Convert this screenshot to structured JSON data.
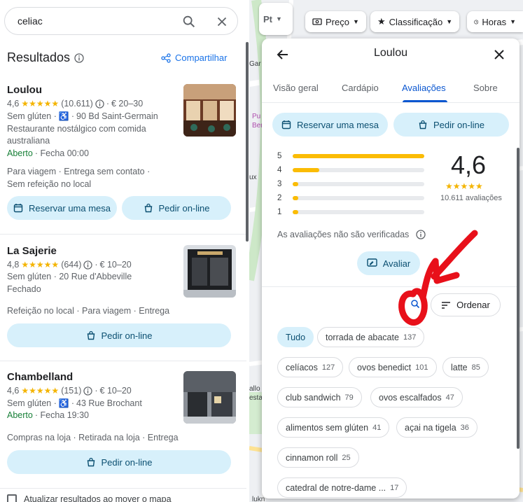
{
  "search": {
    "query": "celiac"
  },
  "results": {
    "title": "Resultados",
    "share_label": "Compartilhar"
  },
  "cards": [
    {
      "name": "Loulou",
      "rating": "4,6",
      "stars": "★★★★★",
      "count": "(10.611)",
      "price": "€ 20–30",
      "line2": "Sem glúten ·",
      "address": "90 Bd Saint-Germain",
      "desc1": "Restaurante nostálgico com comida",
      "desc2": "australiana",
      "status": "Aberto",
      "hours": "· Fecha 00:00",
      "services1": "Para viagem · Entrega sem contato ·",
      "services2": "Sem refeição no local",
      "reserve": "Reservar uma mesa",
      "order": "Pedir on-line"
    },
    {
      "name": "La Sajerie",
      "rating": "4,8",
      "stars": "★★★★★",
      "count": "(644)",
      "price": "€ 10–20",
      "line2": "Sem glúten · 20 Rue d'Abbeville",
      "status": "Fechado",
      "services1": "Refeição no local · Para viagem · Entrega",
      "order": "Pedir on-line"
    },
    {
      "name": "Chambelland",
      "rating": "4,6",
      "stars": "★★★★★",
      "count": "(151)",
      "price": "€ 10–20",
      "line2": "Sem glúten ·",
      "address": "43 Rue Brochant",
      "status": "Aberto",
      "hours": "· Fecha 19:30",
      "services1": "Compras na loja · Retirada na loja · Entrega",
      "order": "Pedir on-line"
    }
  ],
  "map_update_label": "Atualizar resultados ao mover o mapa",
  "map_toolbar": {
    "price": "Preço",
    "rating": "Classificação",
    "hours": "Horas"
  },
  "map_labels": [
    "Gar",
    "Pu",
    "Ber",
    "ux",
    "allo",
    "esta",
    "lukn"
  ],
  "panel": {
    "title": "Loulou",
    "tabs": [
      "Visão geral",
      "Cardápio",
      "Avaliações",
      "Sobre"
    ],
    "active_tab": "Avaliações",
    "reserve": "Reservar uma mesa",
    "order": "Pedir on-line",
    "rating_bars": [
      {
        "label": "5",
        "fraction": 1.0
      },
      {
        "label": "4",
        "fraction": 0.2
      },
      {
        "label": "3",
        "fraction": 0.04
      },
      {
        "label": "2",
        "fraction": 0.04
      },
      {
        "label": "1",
        "fraction": 0.04
      }
    ],
    "score": "4,6",
    "score_stars": "★★★★★",
    "review_count": "10.611 avaliações",
    "unverified": "As avaliações não são verificadas",
    "rate_button": "Avaliar",
    "sort_button": "Ordenar",
    "chips": [
      {
        "label": "Tudo",
        "count": ""
      },
      {
        "label": "torrada de abacate",
        "count": "137"
      },
      {
        "label": "celíacos",
        "count": "127"
      },
      {
        "label": "ovos benedict",
        "count": "101"
      },
      {
        "label": "latte",
        "count": "85"
      },
      {
        "label": "club sandwich",
        "count": "79"
      },
      {
        "label": "ovos escalfados",
        "count": "47"
      },
      {
        "label": "alimentos sem glúten",
        "count": "41"
      },
      {
        "label": "açai na tigela",
        "count": "36"
      },
      {
        "label": "cinnamon roll",
        "count": "25"
      },
      {
        "label": "catedral de notre-dame ...",
        "count": "17"
      }
    ]
  }
}
